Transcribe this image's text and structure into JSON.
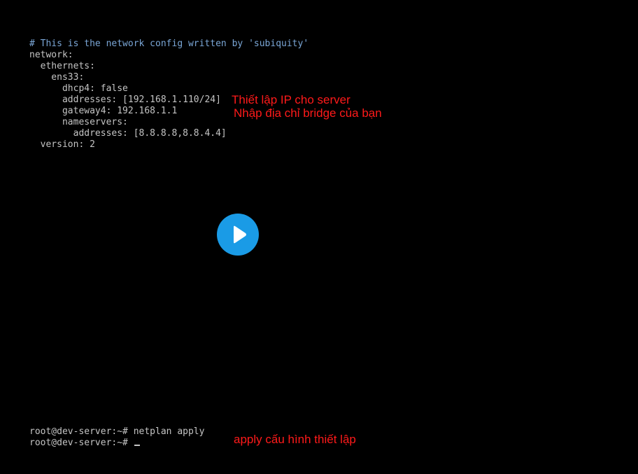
{
  "terminal": {
    "lines": [
      "# This is the network config written by 'subiquity'",
      "network:",
      "  ethernets:",
      "    ens33:",
      "      dhcp4: false",
      "      addresses: [192.168.1.110/24]",
      "      gateway4: 192.168.1.1",
      "      nameservers:",
      "        addresses: [8.8.8.8,8.8.4.4]",
      "  version: 2"
    ],
    "prompt_lines": [
      "root@dev-server:~# netplan apply",
      "root@dev-server:~# "
    ]
  },
  "annotations": {
    "ip_setup": "Thiết lập IP cho server",
    "bridge_address": "Nhập địa chỉ bridge của bạn",
    "apply_config": "apply cấu hình thiết lập"
  },
  "player": {
    "play_icon": "play-icon"
  },
  "colors": {
    "background": "#000000",
    "terminal_text": "#c4c4c4",
    "comment_text": "#7aa6d6",
    "annotation": "#ff1a1a",
    "play_button": "#1a9be6"
  }
}
